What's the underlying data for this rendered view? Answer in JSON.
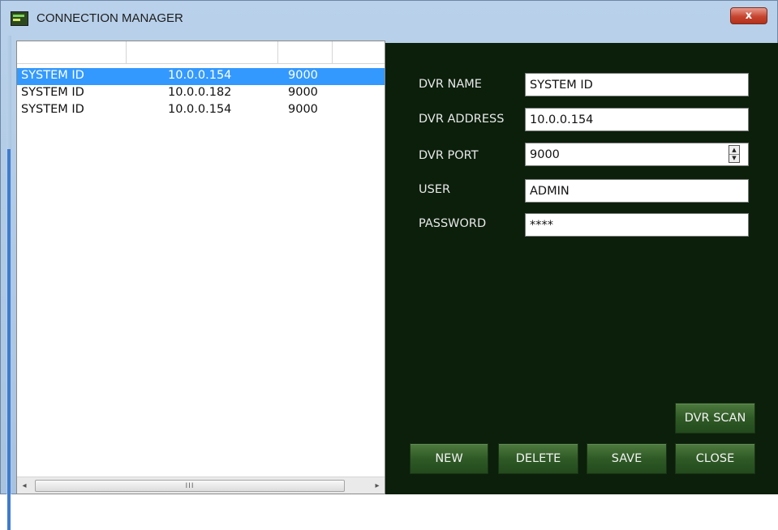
{
  "window": {
    "title": "CONNECTION MANAGER",
    "close_label": "x"
  },
  "list": {
    "columns": [
      "",
      "",
      "",
      ""
    ],
    "rows": [
      {
        "name": "SYSTEM ID",
        "address": "10.0.0.154",
        "port": "9000",
        "selected": true
      },
      {
        "name": "SYSTEM ID",
        "address": "10.0.0.182",
        "port": "9000",
        "selected": false
      },
      {
        "name": "SYSTEM ID",
        "address": "10.0.0.154",
        "port": "9000",
        "selected": false
      }
    ],
    "scroll": {
      "left_arrow": "◂",
      "right_arrow": "▸",
      "thumb_grip": "III"
    }
  },
  "form": {
    "dvr_name": {
      "label": "DVR NAME",
      "value": "SYSTEM ID"
    },
    "dvr_address": {
      "label": "DVR ADDRESS",
      "value": "10.0.0.154"
    },
    "dvr_port": {
      "label": "DVR PORT",
      "value": "9000"
    },
    "user": {
      "label": "USER",
      "value": "ADMIN"
    },
    "password": {
      "label": "PASSWORD",
      "value": "****"
    }
  },
  "buttons": {
    "scan": "DVR SCAN",
    "new": "NEW",
    "delete": "DELETE",
    "save": "SAVE",
    "close": "CLOSE"
  },
  "colors": {
    "panel_bg": "#0b1f0b",
    "button_green": "#2f5a26",
    "selection": "#3399ff"
  }
}
